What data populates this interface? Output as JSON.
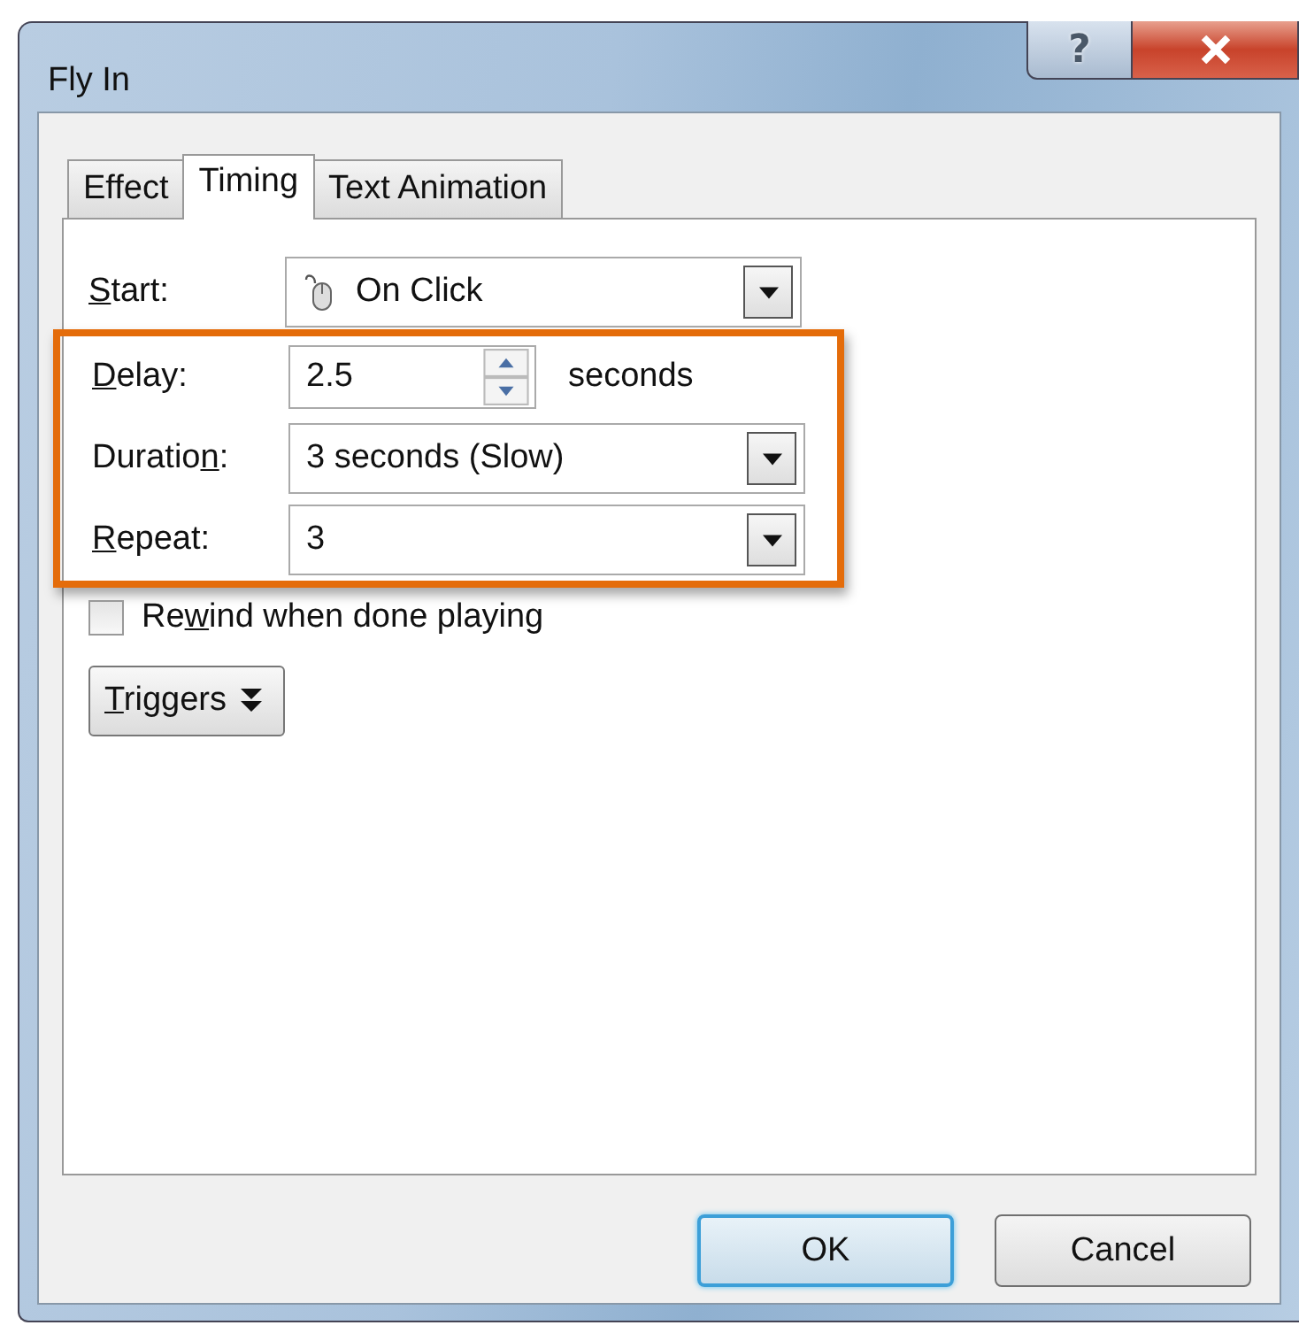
{
  "window": {
    "title": "Fly In",
    "help_label": "?"
  },
  "tabs": [
    {
      "label": "Effect",
      "selected": false
    },
    {
      "label": "Timing",
      "selected": true
    },
    {
      "label": "Text Animation",
      "selected": false
    }
  ],
  "fields": [
    {
      "kind": "mouse-combo",
      "label": {
        "key": "S",
        "after": "tart:"
      },
      "value": "On Click"
    }
  ],
  "highlight_box": {
    "fields": [
      {
        "kind": "spinner",
        "label": {
          "key": "D",
          "after": "elay:"
        },
        "value": "2.5",
        "unit": "seconds"
      },
      {
        "kind": "combo",
        "label": {
          "before": "Duratio",
          "key": "n",
          "after": ":"
        },
        "value": "3 seconds (Slow)"
      },
      {
        "kind": "combo",
        "label": {
          "key": "R",
          "after": "epeat:"
        },
        "value": "3"
      }
    ]
  },
  "rewind": {
    "label": {
      "before": "Re",
      "key": "w",
      "after": "ind when done playing"
    },
    "checked": false
  },
  "triggers": {
    "label": {
      "key": "T",
      "after": "riggers"
    }
  },
  "buttons": [
    {
      "label": "OK",
      "default": true
    },
    {
      "label": "Cancel",
      "default": false
    }
  ]
}
